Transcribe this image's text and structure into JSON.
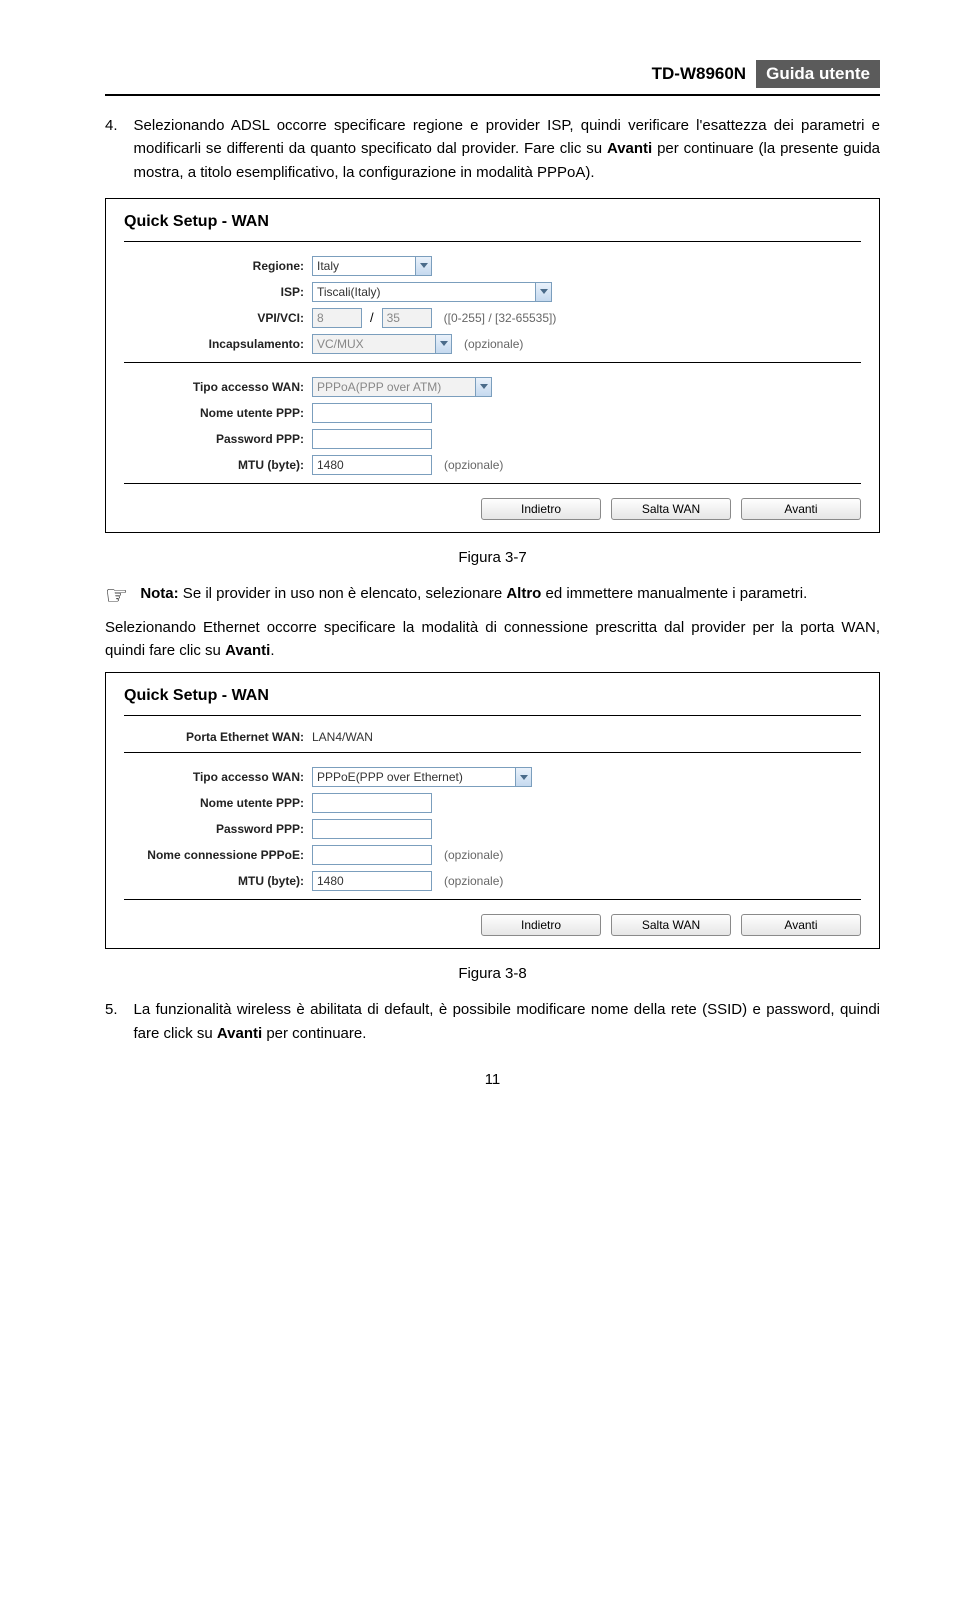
{
  "header": {
    "model": "TD-W8960N",
    "badge": "Guida utente"
  },
  "step4": {
    "num": "4.",
    "text_a": "Selezionando ADSL occorre specificare regione e provider ISP, quindi verificare l'esattezza dei parametri e modificarli se differenti da quanto specificato dal provider. Fare clic su ",
    "bold_a": "Avanti",
    "text_b": " per continuare (la presente guida mostra, a titolo esemplificativo, la configurazione in modalità PPPoA)."
  },
  "panel1": {
    "title": "Quick Setup - WAN",
    "labels": {
      "regione": "Regione:",
      "isp": "ISP:",
      "vpivci": "VPI/VCI:",
      "incaps": "Incapsulamento:",
      "tipo": "Tipo accesso WAN:",
      "user": "Nome utente PPP:",
      "pass": "Password PPP:",
      "mtu": "MTU (byte):"
    },
    "values": {
      "regione": "Italy",
      "isp": "Tiscali(Italy)",
      "vpi": "8",
      "vci": "35",
      "vpivci_hint": "([0-255] / [32-65535])",
      "incaps": "VC/MUX",
      "incaps_hint": "(opzionale)",
      "tipo": "PPPoA(PPP over ATM)",
      "user": "",
      "pass": "",
      "mtu": "1480",
      "mtu_hint": "(opzionale)"
    },
    "buttons": {
      "back": "Indietro",
      "skip": "Salta WAN",
      "next": "Avanti"
    }
  },
  "fig1": "Figura 3-7",
  "note": {
    "prefix": "Nota:",
    "text_a": " Se il provider in uso non è elencato, selezionare ",
    "bold": "Altro",
    "text_b": " ed immettere manualmente i parametri."
  },
  "para2": {
    "text_a": "Selezionando Ethernet occorre specificare la modalità di connessione prescritta dal provider per la porta WAN, quindi fare clic su ",
    "bold": "Avanti",
    "text_b": "."
  },
  "panel2": {
    "title": "Quick Setup - WAN",
    "labels": {
      "porta": "Porta Ethernet WAN:",
      "tipo": "Tipo accesso WAN:",
      "user": "Nome utente PPP:",
      "pass": "Password PPP:",
      "conn": "Nome connessione PPPoE:",
      "mtu": "MTU (byte):"
    },
    "values": {
      "porta": "LAN4/WAN",
      "tipo": "PPPoE(PPP over Ethernet)",
      "user": "",
      "pass": "",
      "conn": "",
      "conn_hint": "(opzionale)",
      "mtu": "1480",
      "mtu_hint": "(opzionale)"
    },
    "buttons": {
      "back": "Indietro",
      "skip": "Salta WAN",
      "next": "Avanti"
    }
  },
  "fig2": "Figura 3-8",
  "step5": {
    "num": "5.",
    "text_a": "La funzionalità wireless è abilitata di default, è possibile modificare nome della rete (SSID) e password, quindi fare click su ",
    "bold": "Avanti",
    "text_b": " per continuare."
  },
  "pagenum": "11"
}
